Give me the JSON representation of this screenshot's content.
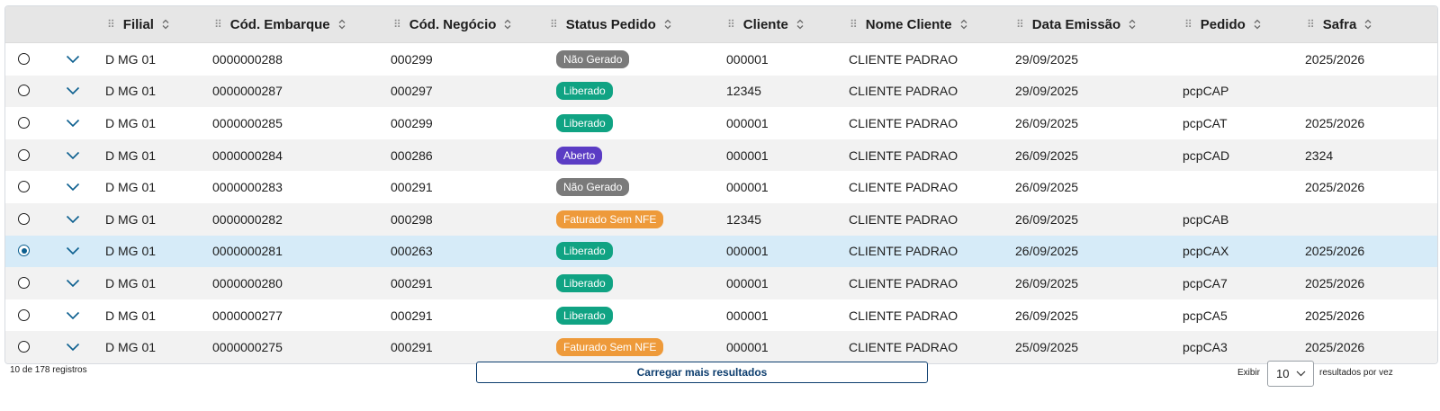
{
  "columns": [
    {
      "label": "Filial"
    },
    {
      "label": "Cód. Embarque"
    },
    {
      "label": "Cód. Negócio"
    },
    {
      "label": "Status Pedido"
    },
    {
      "label": "Cliente"
    },
    {
      "label": "Nome Cliente"
    },
    {
      "label": "Data Emissão"
    },
    {
      "label": "Pedido"
    },
    {
      "label": "Safra"
    }
  ],
  "status_colors": {
    "Não Gerado": "#7a7a7a",
    "Liberado": "#10a383",
    "Aberto": "#5b3cc4",
    "Faturado Sem NFE": "#ee9a3a"
  },
  "selected_row_color": "#d6ebf8",
  "rows": [
    {
      "selected": false,
      "filial": "D MG 01",
      "cod_embarque": "0000000288",
      "cod_negocio": "000299",
      "status": "Não Gerado",
      "cliente": "000001",
      "nome_cliente": "CLIENTE PADRAO",
      "data_emissao": "29/09/2025",
      "pedido": "",
      "safra": "2025/2026"
    },
    {
      "selected": false,
      "filial": "D MG 01",
      "cod_embarque": "0000000287",
      "cod_negocio": "000297",
      "status": "Liberado",
      "cliente": "12345",
      "nome_cliente": "CLIENTE PADRAO",
      "data_emissao": "29/09/2025",
      "pedido": "pcpCAP",
      "safra": ""
    },
    {
      "selected": false,
      "filial": "D MG 01",
      "cod_embarque": "0000000285",
      "cod_negocio": "000299",
      "status": "Liberado",
      "cliente": "000001",
      "nome_cliente": "CLIENTE PADRAO",
      "data_emissao": "26/09/2025",
      "pedido": "pcpCAT",
      "safra": "2025/2026"
    },
    {
      "selected": false,
      "filial": "D MG 01",
      "cod_embarque": "0000000284",
      "cod_negocio": "000286",
      "status": "Aberto",
      "cliente": "000001",
      "nome_cliente": "CLIENTE PADRAO",
      "data_emissao": "26/09/2025",
      "pedido": "pcpCAD",
      "safra": "2324"
    },
    {
      "selected": false,
      "filial": "D MG 01",
      "cod_embarque": "0000000283",
      "cod_negocio": "000291",
      "status": "Não Gerado",
      "cliente": "000001",
      "nome_cliente": "CLIENTE PADRAO",
      "data_emissao": "26/09/2025",
      "pedido": "",
      "safra": "2025/2026"
    },
    {
      "selected": false,
      "filial": "D MG 01",
      "cod_embarque": "0000000282",
      "cod_negocio": "000298",
      "status": "Faturado Sem NFE",
      "cliente": "12345",
      "nome_cliente": "CLIENTE PADRAO",
      "data_emissao": "26/09/2025",
      "pedido": "pcpCAB",
      "safra": ""
    },
    {
      "selected": true,
      "filial": "D MG 01",
      "cod_embarque": "0000000281",
      "cod_negocio": "000263",
      "status": "Liberado",
      "cliente": "000001",
      "nome_cliente": "CLIENTE PADRAO",
      "data_emissao": "26/09/2025",
      "pedido": "pcpCAX",
      "safra": "2025/2026"
    },
    {
      "selected": false,
      "filial": "D MG 01",
      "cod_embarque": "0000000280",
      "cod_negocio": "000291",
      "status": "Liberado",
      "cliente": "000001",
      "nome_cliente": "CLIENTE PADRAO",
      "data_emissao": "26/09/2025",
      "pedido": "pcpCA7",
      "safra": "2025/2026"
    },
    {
      "selected": false,
      "filial": "D MG 01",
      "cod_embarque": "0000000277",
      "cod_negocio": "000291",
      "status": "Liberado",
      "cliente": "000001",
      "nome_cliente": "CLIENTE PADRAO",
      "data_emissao": "26/09/2025",
      "pedido": "pcpCA5",
      "safra": "2025/2026"
    },
    {
      "selected": false,
      "filial": "D MG 01",
      "cod_embarque": "0000000275",
      "cod_negocio": "000291",
      "status": "Faturado Sem NFE",
      "cliente": "000001",
      "nome_cliente": "CLIENTE PADRAO",
      "data_emissao": "25/09/2025",
      "pedido": "pcpCA3",
      "safra": "2025/2026"
    }
  ],
  "footer": {
    "record_count": "10 de 178 registros",
    "load_more_label": "Carregar mais resultados",
    "show_label": "Exibir",
    "page_size": "10",
    "per_page_suffix": "resultados por vez"
  }
}
